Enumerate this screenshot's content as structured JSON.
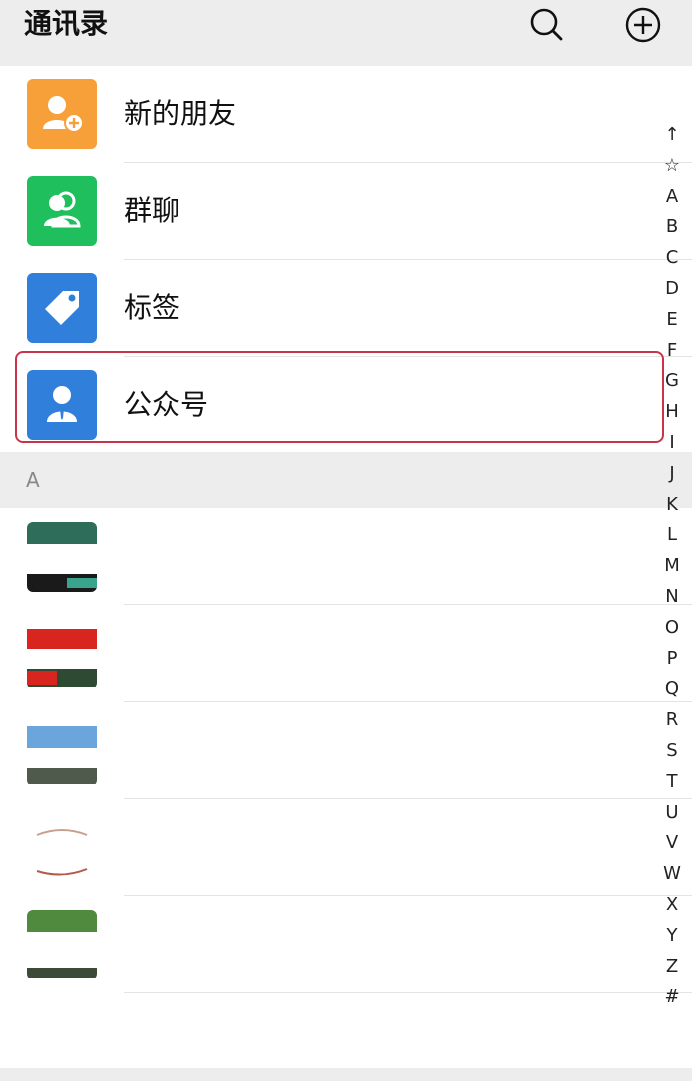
{
  "header": {
    "title": "通讯录",
    "search_icon": "search-icon",
    "add_icon": "plus-circle-icon"
  },
  "menu": [
    {
      "label": "新的朋友",
      "icon": "add-friend-icon",
      "color": "#f7a03a"
    },
    {
      "label": "群聊",
      "icon": "group-chat-icon",
      "color": "#1fbf5e"
    },
    {
      "label": "标签",
      "icon": "tag-icon",
      "color": "#2f7fdb"
    },
    {
      "label": "公众号",
      "icon": "official-account-icon",
      "color": "#2f7fdb"
    }
  ],
  "section": {
    "letter": "A"
  },
  "index_letters": [
    "↑",
    "☆",
    "A",
    "B",
    "C",
    "D",
    "E",
    "F",
    "G",
    "H",
    "I",
    "J",
    "K",
    "L",
    "M",
    "N",
    "O",
    "P",
    "Q",
    "R",
    "S",
    "T",
    "U",
    "V",
    "W",
    "X",
    "Y",
    "Z",
    "#"
  ],
  "colors": {
    "header_bg": "#ededed",
    "highlight_border": "#c8354b",
    "separator": "#e4e4e4"
  }
}
